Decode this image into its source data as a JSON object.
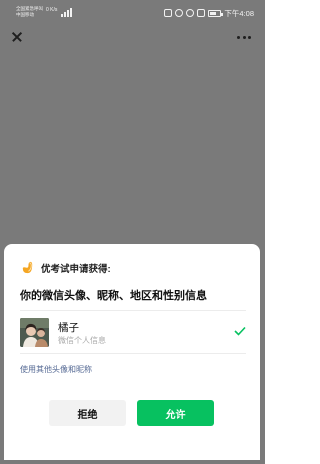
{
  "status_bar": {
    "carrier_line1": "全国紧急呼叫",
    "carrier_line2": "中国移动",
    "net_speed": "0 K/s",
    "time": "下午4:08"
  },
  "sheet": {
    "app_name_text": "优考试申请获得:",
    "request_title": "你的微信头像、昵称、地区和性别信息",
    "profile": {
      "name": "橘子",
      "subtitle": "微信个人信息"
    },
    "other_link": "使用其他头像和昵称",
    "deny_label": "拒绝",
    "allow_label": "允许"
  },
  "colors": {
    "overlay": "#7a7a7a",
    "accent_green": "#07c160",
    "link_blue": "#576b95",
    "logo_orange": "#f5a623"
  },
  "icons": [
    "close-icon",
    "more-icon",
    "app-logo-icon",
    "check-icon",
    "signal-icon",
    "battery-icon"
  ]
}
